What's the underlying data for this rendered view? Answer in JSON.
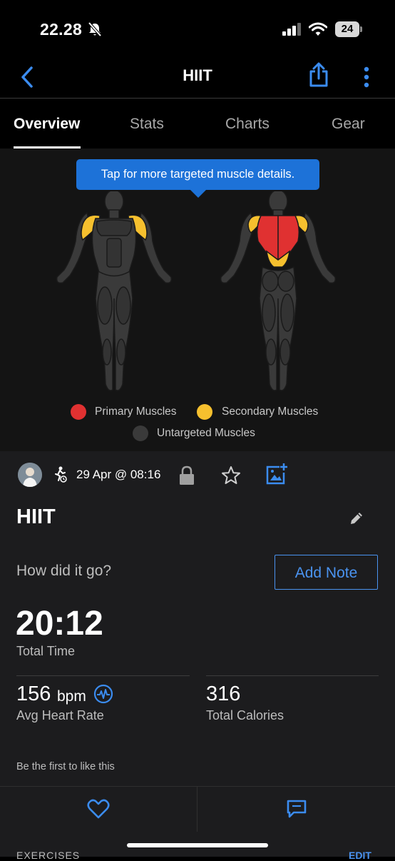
{
  "status_bar": {
    "time": "22.28",
    "battery": "24"
  },
  "nav": {
    "title": "HIIT"
  },
  "tabs": [
    {
      "label": "Overview",
      "active": true
    },
    {
      "label": "Stats",
      "active": false
    },
    {
      "label": "Charts",
      "active": false
    },
    {
      "label": "Gear",
      "active": false
    }
  ],
  "muscle_map": {
    "tooltip": "Tap for more targeted muscle details.",
    "legend": [
      {
        "label": "Primary Muscles",
        "color": "#e03131"
      },
      {
        "label": "Secondary Muscles",
        "color": "#f6c02e"
      },
      {
        "label": "Untargeted Muscles",
        "color": "#3a3a3a"
      }
    ]
  },
  "activity": {
    "datetime": "29 Apr @ 08:16",
    "title": "HIIT",
    "question": "How did it go?",
    "add_note_label": "Add Note",
    "total_time": "20:12",
    "total_time_label": "Total Time",
    "avg_hr_value": "156",
    "avg_hr_unit": "bpm",
    "avg_hr_label": "Avg Heart Rate",
    "calories_value": "316",
    "calories_label": "Total Calories",
    "likes_text": "Be the first to like this"
  },
  "footer": {
    "section_label": "EXERCISES",
    "edit_label": "EDIT"
  },
  "colors": {
    "accent": "#4a93f0",
    "tooltip": "#1d72d8",
    "background": "#1c1c1e"
  }
}
